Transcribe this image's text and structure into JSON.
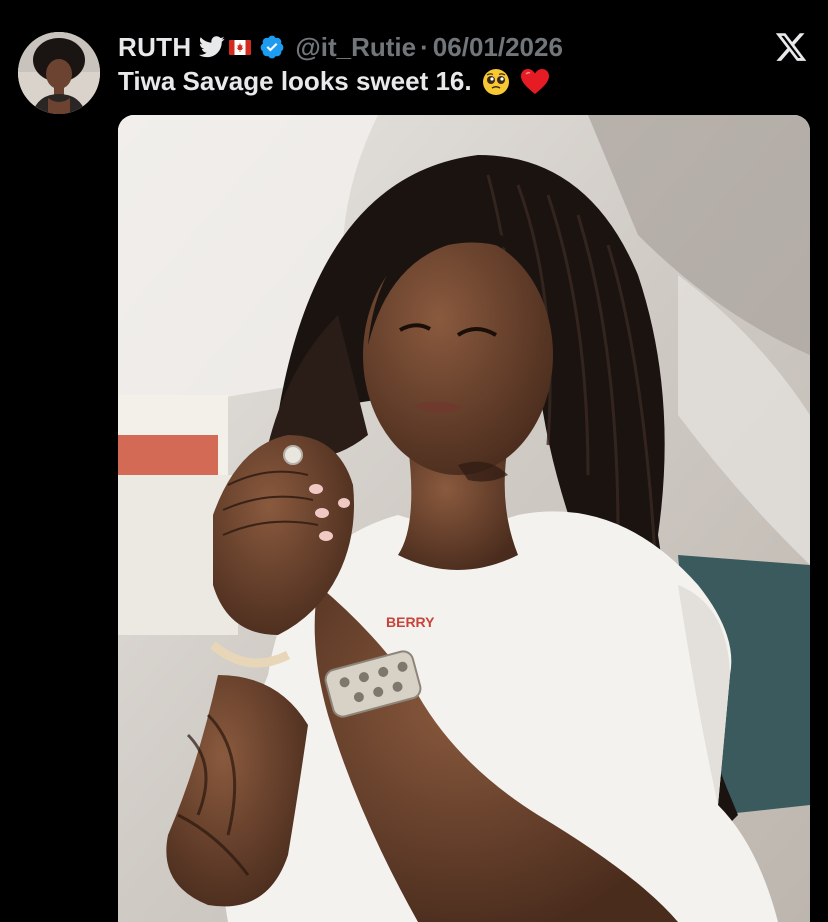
{
  "tweet": {
    "display_name": "RUTH",
    "handle": "@it_Rutie",
    "separator": "·",
    "date": "06/01/2026",
    "text": "Tiwa Savage looks sweet 16.",
    "emojis": [
      "pleading-face-emoji",
      "red-heart-emoji"
    ],
    "badges": [
      "bird-icon",
      "canada-flag-icon",
      "verified-badge-icon"
    ]
  },
  "media": {
    "description_icon": "photo",
    "shirt_text": "BERRY"
  },
  "colors": {
    "background": "#000000",
    "text_primary": "#e7e9ea",
    "text_secondary": "#71767b",
    "verified_blue": "#1d9bf0",
    "flag_red": "#d52b1e"
  }
}
